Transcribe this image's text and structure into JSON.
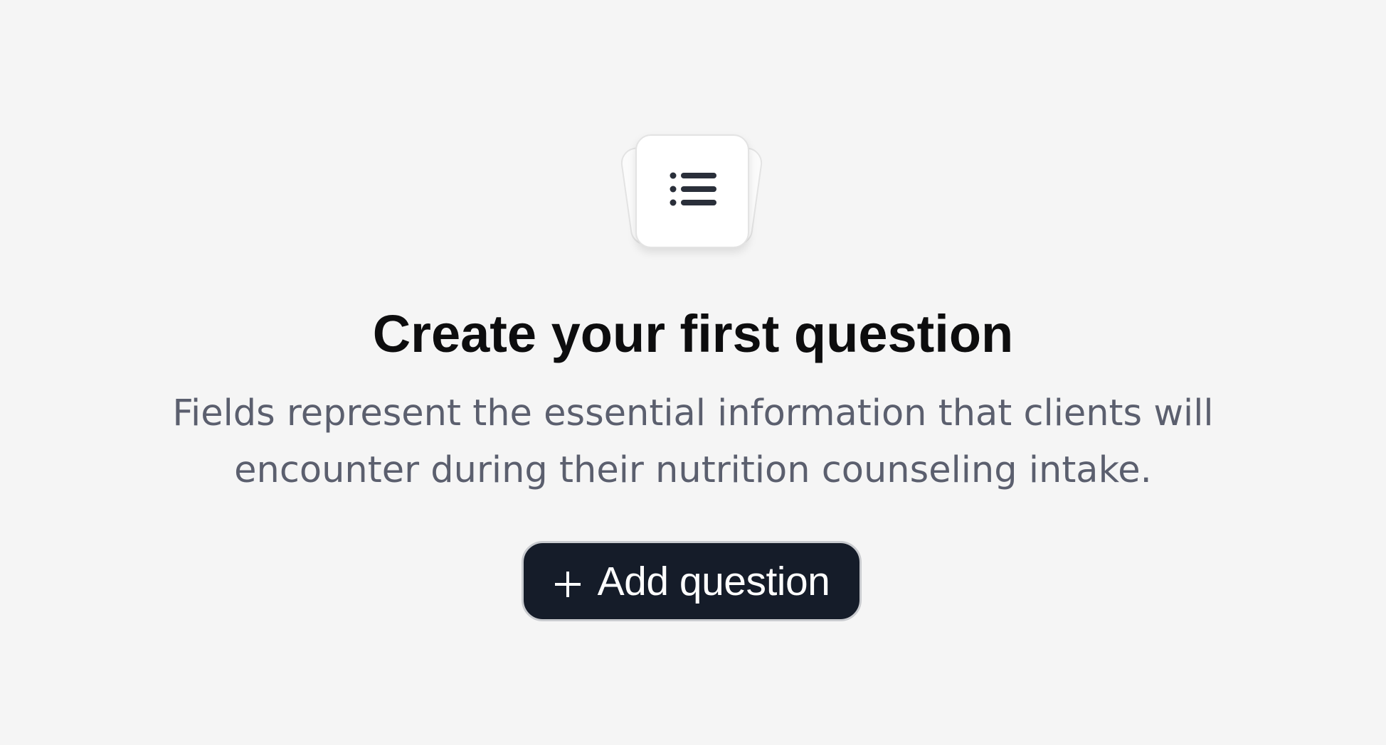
{
  "empty_state": {
    "illustration_icon": "list-icon",
    "title": "Create your first question",
    "description": "Fields represent the essential information that clients will encounter during their nutrition counseling intake.",
    "add_button": {
      "icon": "plus-icon",
      "label": "Add question"
    }
  },
  "colors": {
    "background": "#f5f5f5",
    "title": "#0d0d0e",
    "description": "#5b5f6e",
    "button_background": "#151c29",
    "button_text": "#ffffff"
  }
}
